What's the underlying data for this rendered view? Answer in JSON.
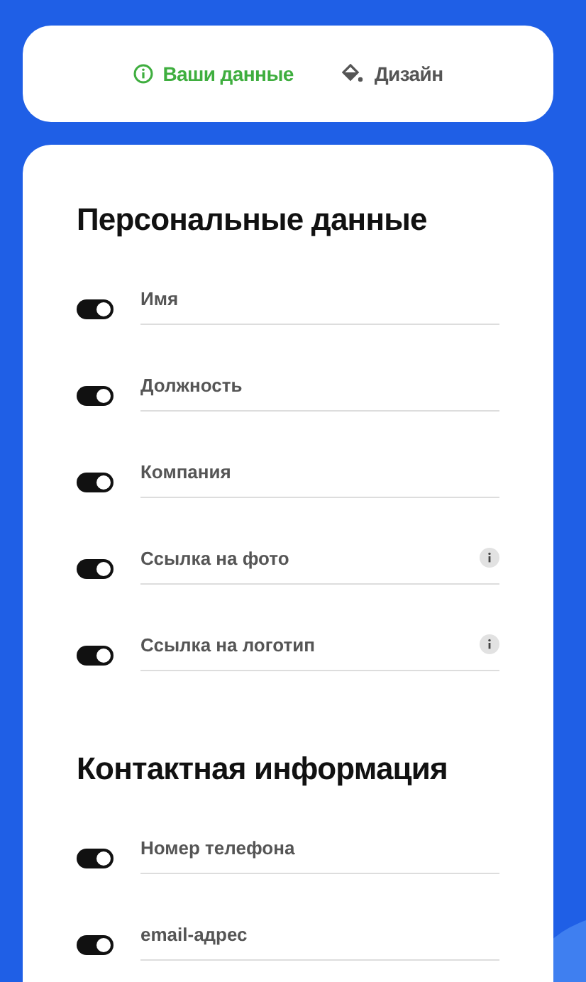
{
  "tabs": [
    {
      "label": "Ваши данные",
      "selected": true
    },
    {
      "label": "Дизайн",
      "selected": false
    }
  ],
  "sections": [
    {
      "title": "Персональные данные",
      "fields": [
        {
          "placeholder": "Имя",
          "on": true,
          "info": false
        },
        {
          "placeholder": "Должность",
          "on": true,
          "info": false
        },
        {
          "placeholder": "Компания",
          "on": true,
          "info": false
        },
        {
          "placeholder": "Ссылка на фото",
          "on": true,
          "info": true
        },
        {
          "placeholder": "Ссылка на логотип",
          "on": true,
          "info": true
        }
      ]
    },
    {
      "title": "Контактная информация",
      "fields": [
        {
          "placeholder": "Номер телефона",
          "on": true,
          "info": false
        },
        {
          "placeholder": "email-адрес",
          "on": true,
          "info": false
        }
      ]
    }
  ]
}
